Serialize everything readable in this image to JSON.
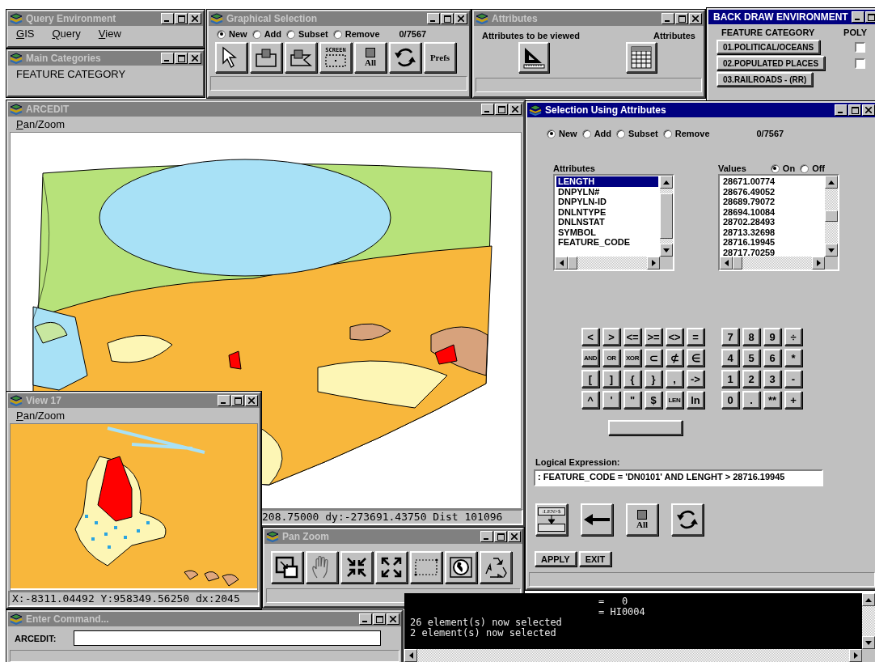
{
  "query_environment": {
    "title": "Query Environment",
    "active": false,
    "menu": [
      "GIS",
      "Query",
      "View"
    ]
  },
  "main_categories": {
    "title": "Main Categories",
    "active": false,
    "text": "FEATURE CATEGORY"
  },
  "graphical_selection": {
    "title": "Graphical Selection",
    "active": false,
    "modes": [
      {
        "label": "New",
        "selected": true
      },
      {
        "label": "Add",
        "selected": false
      },
      {
        "label": "Subset",
        "selected": false
      },
      {
        "label": "Remove",
        "selected": false
      }
    ],
    "count": "0/7567",
    "tools": [
      {
        "kind": "pointer"
      },
      {
        "kind": "box"
      },
      {
        "kind": "polygon"
      },
      {
        "kind": "screen",
        "label": "SCREEN"
      },
      {
        "kind": "all",
        "label": "All"
      },
      {
        "kind": "refresh"
      },
      {
        "kind": "text",
        "label": "Prefs"
      }
    ]
  },
  "attributes": {
    "title": "Attributes",
    "active": false,
    "labels": [
      "Attributes to be viewed",
      "Attributes"
    ],
    "tools": [
      {
        "kind": "set-square"
      },
      {
        "kind": "table"
      }
    ]
  },
  "back_draw": {
    "title": "BACK DRAW ENVIRONMENT",
    "active": true,
    "headers": [
      "FEATURE CATEGORY",
      "POLY"
    ],
    "categories": [
      {
        "label": "01.POLITICAL/OCEANS",
        "checked": false
      },
      {
        "label": "02.POPULATED PLACES",
        "checked": false
      },
      {
        "label": "03.RAILROADS - (RR)"
      }
    ]
  },
  "arcedit": {
    "title": "ARCEDIT",
    "active": false,
    "menu": [
      "Pan/Zoom"
    ],
    "status": "208.75000 dy:-273691.43750 Dist 101096"
  },
  "view_17": {
    "title": "View 17",
    "active": false,
    "menu": [
      "Pan/Zoom"
    ],
    "status": "X:-8311.04492 Y:958349.56250 dx:2045"
  },
  "pan_zoom": {
    "title": "Pan Zoom",
    "active": false,
    "tools": [
      {
        "kind": "zoom-window"
      },
      {
        "kind": "hand"
      },
      {
        "kind": "zoom-in"
      },
      {
        "kind": "zoom-out"
      },
      {
        "kind": "dotted-box"
      },
      {
        "kind": "globe"
      },
      {
        "kind": "recycle"
      }
    ]
  },
  "selection": {
    "title": "Selection Using Attributes",
    "active": true,
    "modes": [
      {
        "label": "New",
        "selected": true
      },
      {
        "label": "Add",
        "selected": false
      },
      {
        "label": "Subset",
        "selected": false
      },
      {
        "label": "Remove",
        "selected": false
      }
    ],
    "count": "0/7567",
    "attributes_label": "Attributes",
    "attributes": [
      {
        "label": "LENGTH",
        "selected": true
      },
      {
        "label": "DNPYLN#",
        "selected": false
      },
      {
        "label": "DNPYLN-ID",
        "selected": false
      },
      {
        "label": "DNLNTYPE",
        "selected": false
      },
      {
        "label": "DNLNSTAT",
        "selected": false
      },
      {
        "label": "SYMBOL",
        "selected": false
      },
      {
        "label": "FEATURE_CODE",
        "selected": false
      }
    ],
    "values_label": "Values",
    "value_display": [
      {
        "label": "On",
        "selected": true
      },
      {
        "label": "Off",
        "selected": false
      }
    ],
    "values": [
      "28671.00774",
      "28676.49052",
      "28689.79072",
      "28694.10084",
      "28702.28493",
      "28713.32698",
      "28716.19945",
      "28717.70259"
    ],
    "operator_keys": [
      {
        "label": "<",
        "kind": "symbol"
      },
      {
        "label": ">",
        "kind": "symbol"
      },
      {
        "label": "<=",
        "kind": "symbol"
      },
      {
        "label": ">=",
        "kind": "symbol"
      },
      {
        "label": "<>",
        "kind": "symbol"
      },
      {
        "label": "=",
        "kind": "symbol"
      },
      {
        "label": "AND",
        "kind": "word"
      },
      {
        "label": "OR",
        "kind": "word"
      },
      {
        "label": "XOR",
        "kind": "word"
      },
      {
        "label": "⊂",
        "kind": "symbol"
      },
      {
        "label": "⊄",
        "kind": "symbol"
      },
      {
        "label": "∈",
        "kind": "symbol"
      },
      {
        "label": "[",
        "kind": "symbol"
      },
      {
        "label": "]",
        "kind": "symbol"
      },
      {
        "label": "{",
        "kind": "symbol"
      },
      {
        "label": "}",
        "kind": "symbol"
      },
      {
        "label": ",",
        "kind": "symbol"
      },
      {
        "label": "->",
        "kind": "symbol"
      },
      {
        "label": "^",
        "kind": "symbol"
      },
      {
        "label": "'",
        "kind": "symbol"
      },
      {
        "label": "\"",
        "kind": "symbol"
      },
      {
        "label": "$",
        "kind": "symbol"
      },
      {
        "label": "LEN",
        "kind": "word"
      },
      {
        "label": "ln",
        "kind": "symbol"
      }
    ],
    "number_keys": [
      "7",
      "8",
      "9",
      "÷",
      "4",
      "5",
      "6",
      "*",
      "1",
      "2",
      "3",
      "-",
      "0",
      ".",
      "**",
      "+"
    ],
    "expression_label": "Logical Expression:",
    "expression": ": FEATURE_CODE = 'DN0101' AND LENGHT > 28716.19945",
    "tools": [
      {
        "kind": "expression-to-field",
        "label": ":LEN>$"
      },
      {
        "kind": "arrow-left"
      },
      {
        "kind": "all",
        "label": "All"
      },
      {
        "kind": "refresh"
      }
    ],
    "buttons": [
      "APPLY",
      "EXIT"
    ]
  },
  "enter_command": {
    "title": "Enter Command...",
    "active": false,
    "label": "ARCEDIT:"
  },
  "console": {
    "lines": [
      {
        "text": "=   0",
        "indented": true
      },
      {
        "text": "= HI0004",
        "indented": true
      },
      {
        "text": "26 element(s) now selected",
        "indented": false
      },
      {
        "text": "2 element(s) now selected",
        "indented": false
      }
    ]
  }
}
